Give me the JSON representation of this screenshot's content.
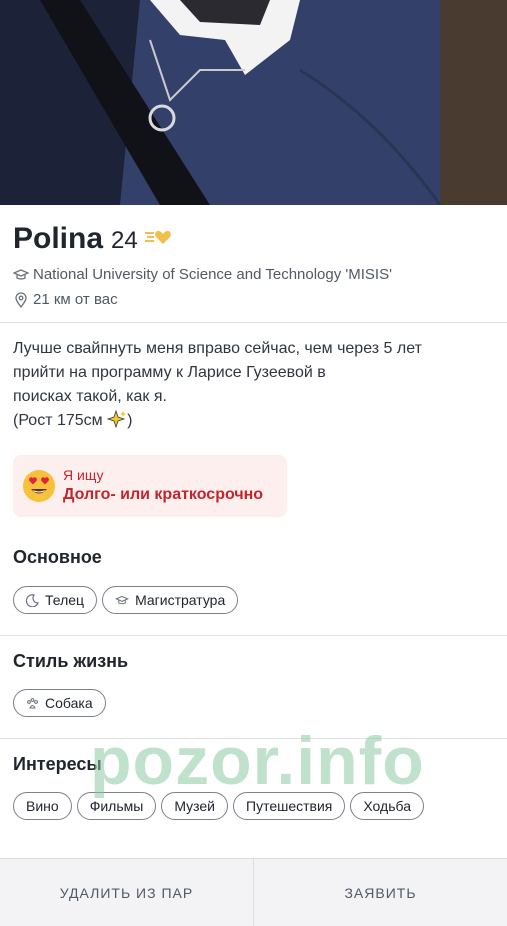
{
  "profile": {
    "name": "Polina",
    "age": "24",
    "university": "National University of Science and Technology 'MISIS'",
    "distance": "21 км от вас",
    "bio": "Лучше свайпнуть меня вправо сейчас, чем через 5 лет\nприйти на программу к Ларисе Гузеевой в\nпоисках такой, как я.\n(Рост 175см",
    "bio_suffix": ")"
  },
  "looking_for": {
    "label": "Я ищу",
    "value": "Долго- или краткосрочно",
    "emoji": "heart-eyes-emoji"
  },
  "sections": {
    "basics": {
      "title": "Основное",
      "chips": [
        {
          "label": "Телец",
          "icon": "moon-icon"
        },
        {
          "label": "Магистратура",
          "icon": "graduation-cap-icon"
        }
      ]
    },
    "lifestyle": {
      "title": "Стиль жизнь",
      "chips": [
        {
          "label": "Собака",
          "icon": "paw-icon"
        }
      ]
    },
    "interests": {
      "title": "Интересы",
      "chips": [
        "Вино",
        "Фильмы",
        "Музей",
        "Путешествия",
        "Ходьба"
      ]
    }
  },
  "watermark": "pozor.info",
  "actions": {
    "remove": "УДАЛИТЬ ИЗ ПАР",
    "report": "ЗАЯВИТЬ"
  },
  "colors": {
    "accent_red": "#c0262c",
    "card_bg": "#fdefee",
    "text": "#21262e",
    "muted": "#505965"
  }
}
